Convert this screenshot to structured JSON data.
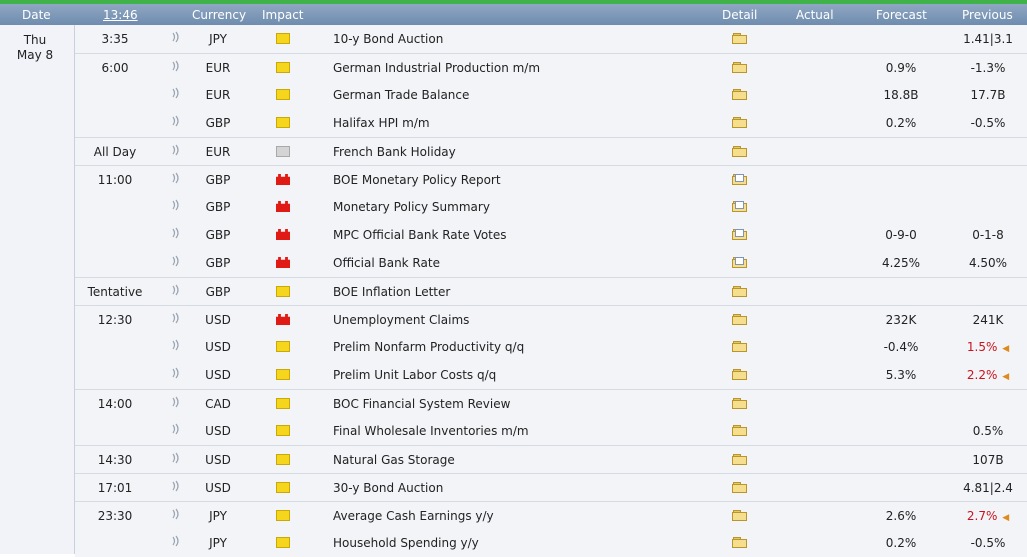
{
  "header": {
    "date": "Date",
    "clock": "13:46",
    "currency": "Currency",
    "impact": "Impact",
    "detail": "Detail",
    "actual": "Actual",
    "forecast": "Forecast",
    "previous": "Previous"
  },
  "date": {
    "line1": "Thu",
    "line2": "May 8"
  },
  "colors": {
    "accent": "#3fb34a",
    "header_bg": "#7690b3",
    "highlight": "#f4f20b",
    "negative": "#c8141e"
  },
  "rows": [
    {
      "time": "3:35",
      "currency": "JPY",
      "impact": "yellow",
      "event": "10-y Bond Auction",
      "detail_icon": "folder-icon",
      "actual": "",
      "forecast": "",
      "previous": "1.41|3.1",
      "prev_red": false,
      "group_start": true
    },
    {
      "time": "6:00",
      "currency": "EUR",
      "impact": "yellow",
      "event": "German Industrial Production m/m",
      "detail_icon": "folder-icon",
      "actual": "",
      "forecast": "0.9%",
      "previous": "-1.3%",
      "prev_red": false,
      "group_start": true
    },
    {
      "time": "",
      "currency": "EUR",
      "impact": "yellow",
      "event": "German Trade Balance",
      "detail_icon": "folder-icon",
      "actual": "",
      "forecast": "18.8B",
      "previous": "17.7B",
      "prev_red": false,
      "group_start": false
    },
    {
      "time": "",
      "currency": "GBP",
      "impact": "yellow",
      "event": "Halifax HPI m/m",
      "detail_icon": "folder-icon",
      "actual": "",
      "forecast": "0.2%",
      "previous": "-0.5%",
      "prev_red": false,
      "group_start": false
    },
    {
      "time": "All Day",
      "currency": "EUR",
      "impact": "grey",
      "event": "French Bank Holiday",
      "detail_icon": "folder-icon",
      "actual": "",
      "forecast": "",
      "previous": "",
      "prev_red": false,
      "group_start": true
    },
    {
      "time": "11:00",
      "currency": "GBP",
      "impact": "red",
      "event": "BOE Monetary Policy Report",
      "detail_icon": "folder-document-icon",
      "actual": "",
      "forecast": "",
      "previous": "",
      "prev_red": false,
      "group_start": true
    },
    {
      "time": "",
      "currency": "GBP",
      "impact": "red",
      "event": "Monetary Policy Summary",
      "detail_icon": "folder-document-icon",
      "actual": "",
      "forecast": "",
      "previous": "",
      "prev_red": false,
      "group_start": false
    },
    {
      "time": "",
      "currency": "GBP",
      "impact": "red",
      "event": "MPC Official Bank Rate Votes",
      "detail_icon": "folder-document-icon",
      "actual": "",
      "forecast": "0-9-0",
      "previous": "0-1-8",
      "prev_red": false,
      "group_start": false
    },
    {
      "time": "",
      "currency": "GBP",
      "impact": "red",
      "event": "Official Bank Rate",
      "detail_icon": "folder-document-icon",
      "actual": "",
      "forecast": "4.25%",
      "previous": "4.50%",
      "prev_red": false,
      "group_start": false
    },
    {
      "time": "Tentative",
      "currency": "GBP",
      "impact": "yellow",
      "event": "BOE Inflation Letter",
      "detail_icon": "folder-icon",
      "actual": "",
      "forecast": "",
      "previous": "",
      "prev_red": false,
      "group_start": true
    },
    {
      "time": "12:30",
      "currency": "USD",
      "impact": "red",
      "event": "Unemployment Claims",
      "detail_icon": "folder-icon",
      "actual": "",
      "forecast": "232K",
      "previous": "241K",
      "prev_red": false,
      "group_start": true
    },
    {
      "time": "",
      "currency": "USD",
      "impact": "yellow",
      "event": "Prelim Nonfarm Productivity q/q",
      "detail_icon": "folder-icon",
      "actual": "",
      "forecast": "-0.4%",
      "previous": "1.5%",
      "prev_red": true,
      "group_start": false
    },
    {
      "time": "",
      "currency": "USD",
      "impact": "yellow",
      "event": "Prelim Unit Labor Costs q/q",
      "detail_icon": "folder-icon",
      "actual": "",
      "forecast": "5.3%",
      "previous": "2.2%",
      "prev_red": true,
      "group_start": false
    },
    {
      "time": "14:00",
      "currency": "CAD",
      "impact": "yellow",
      "event": "BOC Financial System Review",
      "detail_icon": "folder-icon",
      "actual": "",
      "forecast": "",
      "previous": "",
      "prev_red": false,
      "group_start": true
    },
    {
      "time": "",
      "currency": "USD",
      "impact": "yellow",
      "event": "Final Wholesale Inventories m/m",
      "detail_icon": "folder-icon",
      "actual": "",
      "forecast": "",
      "previous": "0.5%",
      "prev_red": false,
      "group_start": false
    },
    {
      "time": "14:30",
      "currency": "USD",
      "impact": "yellow",
      "event": "Natural Gas Storage",
      "detail_icon": "folder-icon",
      "actual": "",
      "forecast": "",
      "previous": "107B",
      "prev_red": false,
      "group_start": true
    },
    {
      "time": "17:01",
      "currency": "USD",
      "impact": "yellow",
      "event": "30-y Bond Auction",
      "detail_icon": "folder-icon",
      "actual": "",
      "forecast": "",
      "previous": "4.81|2.4",
      "prev_red": false,
      "group_start": true
    },
    {
      "time": "23:30",
      "currency": "JPY",
      "impact": "yellow",
      "event": "Average Cash Earnings y/y",
      "detail_icon": "folder-icon",
      "actual": "",
      "forecast": "2.6%",
      "previous": "2.7%",
      "prev_red": true,
      "group_start": true
    },
    {
      "time": "",
      "currency": "JPY",
      "impact": "yellow",
      "event": "Household Spending y/y",
      "detail_icon": "folder-icon",
      "actual": "",
      "forecast": "0.2%",
      "previous": "-0.5%",
      "prev_red": false,
      "group_start": false
    }
  ]
}
